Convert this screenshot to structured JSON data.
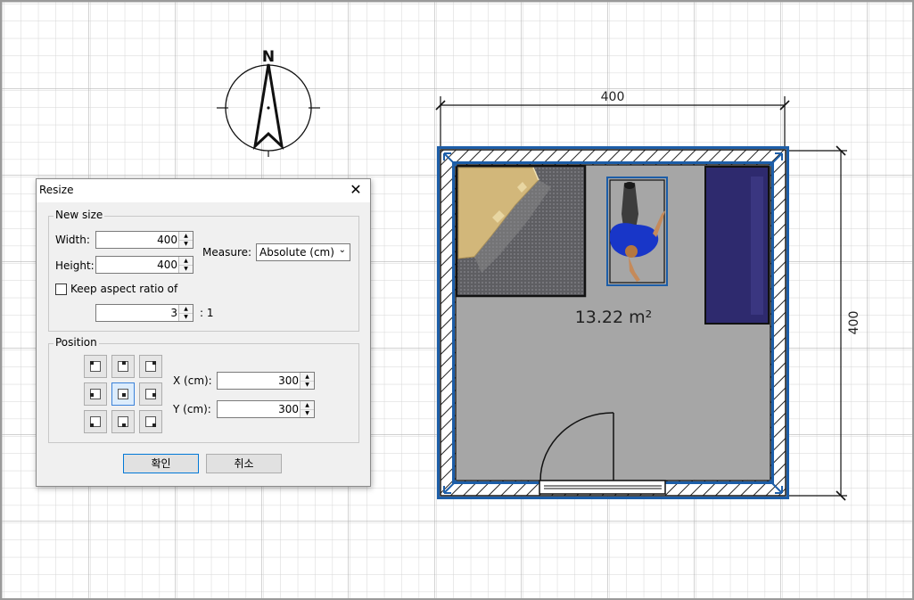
{
  "plan": {
    "dimension_top": "400",
    "dimension_right": "400",
    "room_area": "13.22 m²",
    "compass_label": "N"
  },
  "dialog": {
    "title": "Resize",
    "close_glyph": "✕",
    "new_size_legend": "New size",
    "width_label": "Width:",
    "width_value": "400",
    "height_label": "Height:",
    "height_value": "400",
    "measure_label": "Measure:",
    "measure_value": "Absolute (cm)",
    "keep_aspect_label": "Keep aspect ratio of",
    "keep_aspect_checked": false,
    "ratio_value": "3",
    "ratio_suffix": ": 1",
    "position_legend": "Position",
    "x_label": "X (cm):",
    "x_value": "300",
    "y_label": "Y (cm):",
    "y_value": "300",
    "selected_anchor": "center",
    "ok_label": "확인",
    "cancel_label": "취소"
  },
  "colors": {
    "grid": "#c9c9c9",
    "wall_selection": "#1d5ea8",
    "floor": "#a6a6a6",
    "bed": "#2e2a6e",
    "desk": "#d2b77a",
    "person_shirt": "#1836c8"
  }
}
